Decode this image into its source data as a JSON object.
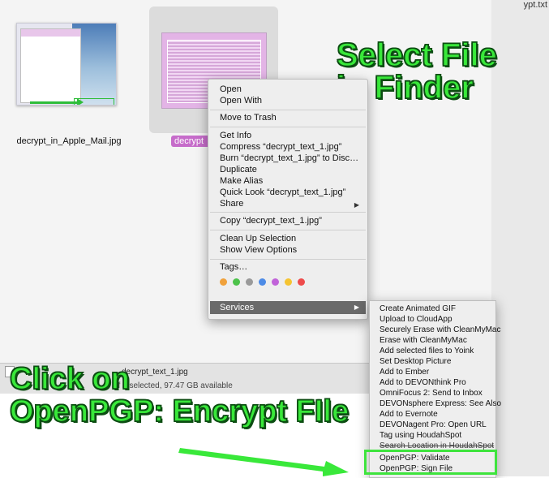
{
  "top_right_text": "ypt.txt",
  "files": [
    {
      "name": "decrypt_in_Apple_Mail.jpg"
    },
    {
      "name": "decrypt_text_1.jpg",
      "visible_label": "decrypt"
    }
  ],
  "callouts": {
    "select_line1": "Select File",
    "select_line2": "in Finder",
    "click_line1": "Click on",
    "click_line2": "OpenPGP: Encrypt FIle"
  },
  "statusbar": {
    "path_text": "decrypt_text_1.jpg",
    "status_text": "of 2 selected, 97.47 GB available"
  },
  "context_menu": {
    "open": "Open",
    "open_with": "Open With",
    "move_to_trash": "Move to Trash",
    "get_info": "Get Info",
    "compress": "Compress “decrypt_text_1.jpg”",
    "burn": "Burn “decrypt_text_1.jpg” to Disc…",
    "duplicate": "Duplicate",
    "make_alias": "Make Alias",
    "quick_look": "Quick Look “decrypt_text_1.jpg”",
    "share": "Share",
    "copy": "Copy “decrypt_text_1.jpg”",
    "clean_up": "Clean Up Selection",
    "show_view_options": "Show View Options",
    "tags": "Tags…",
    "services": "Services",
    "tag_colors": [
      "#f0a13b",
      "#4cc24a",
      "#9a9a9a",
      "#4d8be6",
      "#c163d9",
      "#f5c431",
      "#ee4b4b"
    ]
  },
  "services_menu": [
    "Create Animated GIF",
    "Upload to CloudApp",
    "Securely Erase with CleanMyMac",
    "Erase with CleanMyMac",
    "Add selected files to Yoink",
    "Set Desktop Picture",
    "Add to Ember",
    "Add to DEVONthink Pro",
    "OmniFocus 2: Send to Inbox",
    "DEVONsphere Express: See Also",
    "Add to Evernote",
    "DEVONagent Pro: Open URL",
    "Tag using HoudahSpot",
    "Search Location in HoudahSpot",
    "OpenPGP: Validate",
    "OpenPGP: Sign File"
  ],
  "colors": {
    "accent_green": "#39e83a",
    "selection_label": "#c66cca",
    "services_highlight": "#6a6a6a"
  }
}
